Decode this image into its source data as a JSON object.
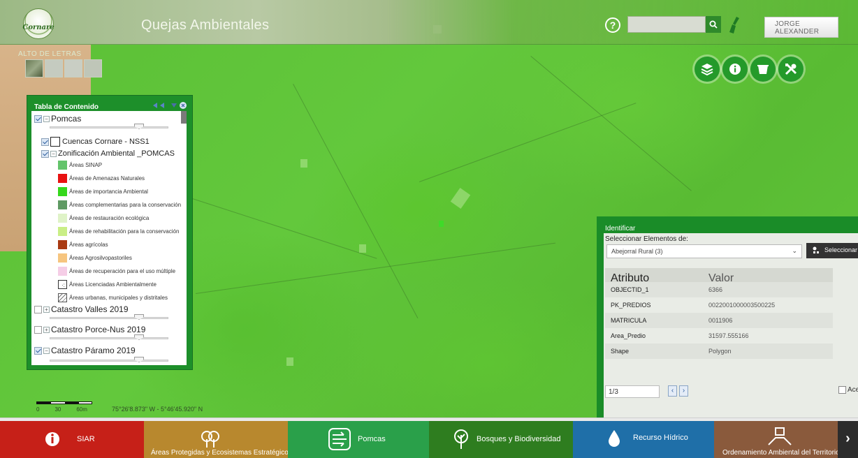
{
  "header": {
    "logo_text": "Cornare",
    "app_title": "Quejas Ambientales",
    "help_glyph": "?",
    "search_placeholder": "",
    "user_name_line1": "JORGE",
    "user_name_line2": "ALEXANDER"
  },
  "map": {
    "alto_label": "ALTO DE LETRAS",
    "coordinates": "75°26'8.873\" W - 5°46'45.920\" N",
    "scale_labels": [
      "0",
      "30",
      "60m"
    ]
  },
  "tools": [
    "layers-icon",
    "info-icon",
    "bucket-icon",
    "tools-icon"
  ],
  "toc": {
    "title": "Tabla de Contenido",
    "groups": {
      "pomcas": "Pomcas",
      "cuencas": "Cuencas Cornare - NSS1",
      "zonificacion": "Zonificación Ambiental _POMCAS",
      "valles": "Catastro Valles 2019",
      "porce": "Catastro Porce-Nus 2019",
      "paramo": "Catastro Páramo 2019"
    },
    "legend": [
      {
        "label": "Áreas SINAP",
        "color": "#63c46b"
      },
      {
        "label": "Áreas de Amenazas Naturales",
        "color": "#e81212"
      },
      {
        "label": "Áreas de importancia Ambiental",
        "color": "#35d81c"
      },
      {
        "label": "Áreas complementarias para la conservación",
        "color": "#5f9a63"
      },
      {
        "label": "Áreas de restauración ecológica",
        "color": "#dff3c7"
      },
      {
        "label": "Áreas de rehabilitación para la conservación",
        "color": "#c9ee86"
      },
      {
        "label": "Áreas agrícolas",
        "color": "#a93a12"
      },
      {
        "label": "Áreas Agrosilvopastoriles",
        "color": "#f6c57f"
      },
      {
        "label": "Áreas de recuperación para el uso múltiple",
        "color": "#f5cde6"
      },
      {
        "label": "Áreas Licenciadas Ambientalmente",
        "color": "#ffffff"
      },
      {
        "label": "Áreas urbanas, municipales y distritales",
        "color": "#ffffff"
      }
    ]
  },
  "identify": {
    "title": "Identificar",
    "select_label": "Seleccionar Elementos de:",
    "selected_option": "Abejorral Rural (3)",
    "select_button": "Seleccionar",
    "columns": [
      "Atributo",
      "Valor"
    ],
    "rows": [
      {
        "attr": "OBJECTID_1",
        "value": "6366"
      },
      {
        "attr": "PK_PREDIOS",
        "value": "0022001000003500225"
      },
      {
        "attr": "MATRICULA",
        "value": "0011906"
      },
      {
        "attr": "Area_Predio",
        "value": "31597.555166"
      },
      {
        "attr": "Shape",
        "value": "Polygon"
      }
    ],
    "pager": "1/3",
    "checkbox_label": "Ace"
  },
  "nav": [
    {
      "label": "SIAR",
      "color": "#c62018"
    },
    {
      "label": "Áreas Protegidas y Ecosistemas Estratégicos",
      "color": "#b8882e"
    },
    {
      "label": "Pomcas",
      "color": "#2aa04a"
    },
    {
      "label": "Bosques y Biodiversidad",
      "color": "#2e7d1f"
    },
    {
      "label": "Recurso Hídrico",
      "color": "#1f6fa8"
    },
    {
      "label": "Ordenamiento Ambiental del Territorio y",
      "color": "#8a5a3c"
    }
  ]
}
